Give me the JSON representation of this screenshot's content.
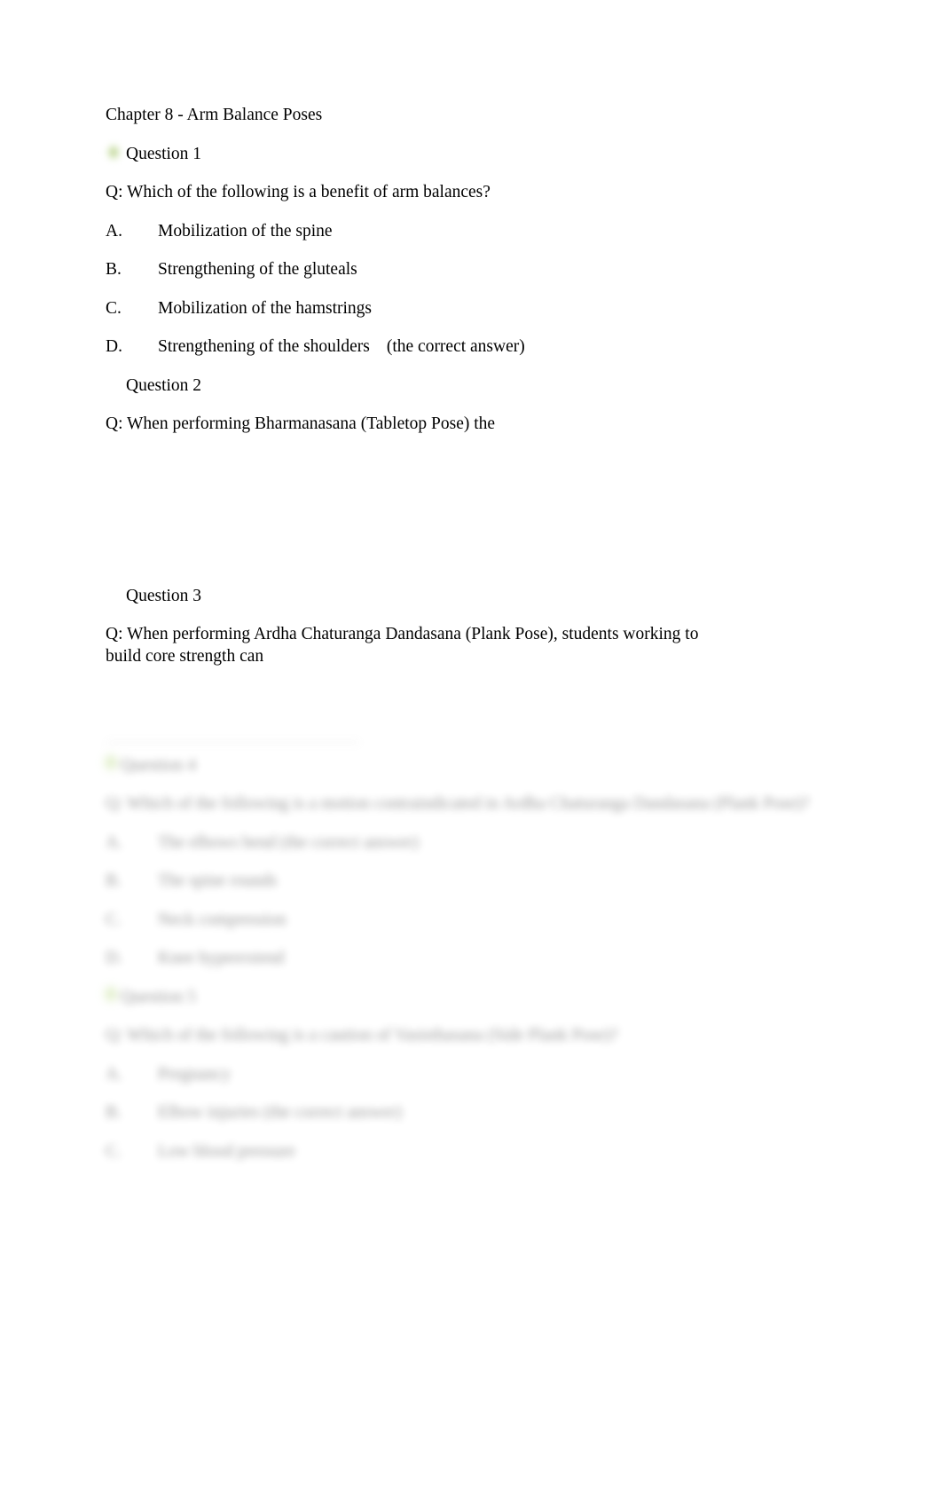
{
  "document": {
    "title": "Chapter 8 - Arm Balance Poses",
    "highlight_color": "#b4ce83"
  },
  "question1": {
    "heading": "Question 1",
    "prompt": "Q: Which of the following is a benefit of arm balances?",
    "options": [
      {
        "letter": "A.",
        "text": "Mobilization of the spine",
        "note": ""
      },
      {
        "letter": "B.",
        "text": "Strengthening of the gluteals",
        "note": ""
      },
      {
        "letter": "C.",
        "text": "Mobilization of the hamstrings",
        "note": ""
      },
      {
        "letter": "D.",
        "text": "Strengthening of the shoulders",
        "note": "(the correct answer)"
      }
    ]
  },
  "question2": {
    "heading": "Question 2",
    "prompt": "Q: When performing Bharmanasana (Tabletop Pose) the"
  },
  "question3": {
    "heading": "Question 3",
    "prompt": "Q: When performing Ardha Chaturanga Dandasana (Plank Pose), students working to build core strength can"
  },
  "question4": {
    "heading": "Question 4",
    "prompt": "Q: Which of the following is a motion contraindicated in Ardha Chaturanga Dandasana (Plank Pose)?",
    "options": [
      {
        "letter": "A.",
        "text": "The elbows bend  (the correct answer)",
        "note": ""
      },
      {
        "letter": "B.",
        "text": "The spine rounds",
        "note": ""
      },
      {
        "letter": "C.",
        "text": "Neck compression",
        "note": ""
      },
      {
        "letter": "D.",
        "text": "Knee hyperextend",
        "note": ""
      }
    ]
  },
  "question5": {
    "heading": "Question 5",
    "prompt": "Q: Which of the following is a caution of Vasisthasana (Side Plank Pose)?",
    "options": [
      {
        "letter": "A.",
        "text": "Pregnancy",
        "note": ""
      },
      {
        "letter": "B.",
        "text": "Elbow injuries  (the correct answer)",
        "note": ""
      },
      {
        "letter": "C.",
        "text": "Low blood pressure",
        "note": ""
      }
    ]
  }
}
